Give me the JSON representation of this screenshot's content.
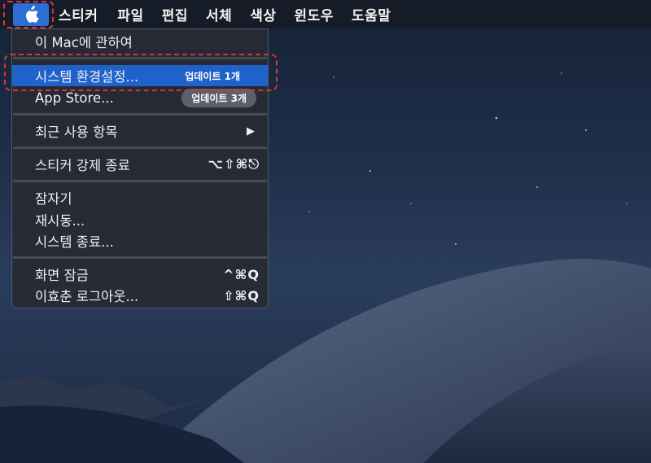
{
  "menubar": {
    "apple_icon": "apple-logo-icon",
    "items": [
      "스티커",
      "파일",
      "편집",
      "서체",
      "색상",
      "윈도우",
      "도움말"
    ]
  },
  "menu": {
    "about": "이 Mac에 관하여",
    "system_prefs": "시스템 환경설정...",
    "system_prefs_badge": "업데이트 1개",
    "app_store": "App Store...",
    "app_store_badge": "업데이트 3개",
    "recent_items": "최근 사용 항목",
    "force_quit": "스티커 강제 종료",
    "force_quit_shortcut": "⌥⇧⌘⎋",
    "sleep": "잠자기",
    "restart": "재시동...",
    "shutdown": "시스템 종료...",
    "lock_screen": "화면 잠금",
    "lock_screen_shortcut": "^⌘Q",
    "logout": "이효춘 로그아웃...",
    "logout_shortcut": "⇧⌘Q"
  },
  "colors": {
    "highlight": "#1f62c9",
    "annotation": "#d6373d"
  }
}
